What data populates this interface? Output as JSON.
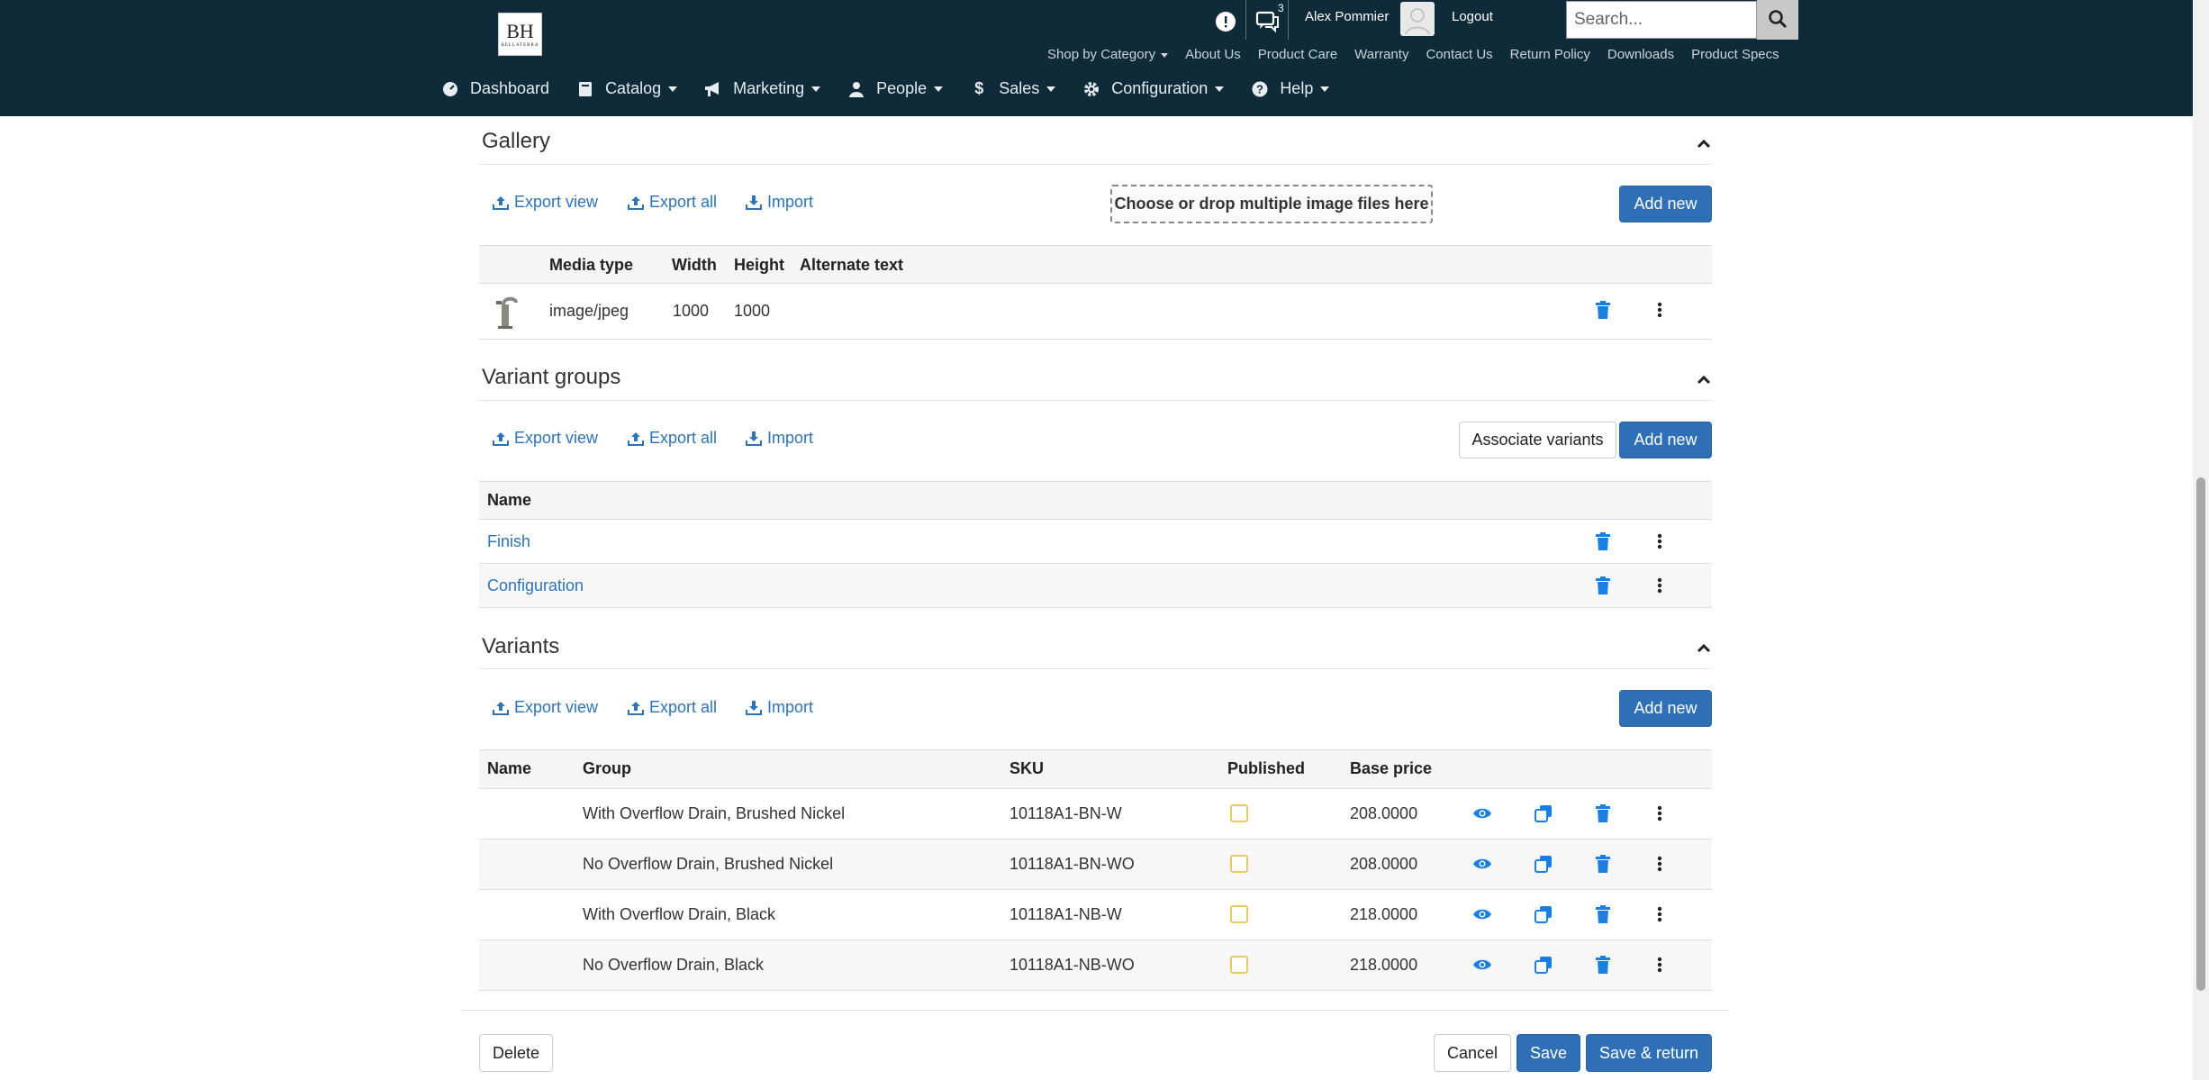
{
  "header": {
    "logo_text": "BH",
    "logo_sub": "BELLATERRA",
    "notifications_badge": "",
    "messages_badge": "3",
    "user_name": "Alex Pommier",
    "logout_label": "Logout",
    "search_placeholder": "Search...",
    "top_links": [
      "Shop by Category",
      "About Us",
      "Product Care",
      "Warranty",
      "Contact Us",
      "Return Policy",
      "Downloads",
      "Product Specs"
    ],
    "nav": [
      "Dashboard",
      "Catalog",
      "Marketing",
      "People",
      "Sales",
      "Configuration",
      "Help"
    ]
  },
  "toolbar": {
    "export_view": "Export view",
    "export_all": "Export all",
    "import": "Import",
    "add_new": "Add new"
  },
  "gallery": {
    "title": "Gallery",
    "dropzone": "Choose or drop multiple image files here",
    "columns": [
      "Media type",
      "Width",
      "Height",
      "Alternate text"
    ],
    "rows": [
      {
        "media_type": "image/jpeg",
        "width": "1000",
        "height": "1000",
        "alt": ""
      }
    ]
  },
  "variant_groups": {
    "title": "Variant groups",
    "associate_label": "Associate variants",
    "columns": [
      "Name"
    ],
    "rows": [
      {
        "name": "Finish"
      },
      {
        "name": "Configuration"
      }
    ]
  },
  "variants": {
    "title": "Variants",
    "columns": [
      "Name",
      "Group",
      "SKU",
      "Published",
      "Base price"
    ],
    "rows": [
      {
        "name": "",
        "group": "With Overflow Drain, Brushed Nickel",
        "sku": "10118A1-BN-W",
        "published": false,
        "price": "208.0000"
      },
      {
        "name": "",
        "group": "No Overflow Drain, Brushed Nickel",
        "sku": "10118A1-BN-WO",
        "published": false,
        "price": "208.0000"
      },
      {
        "name": "",
        "group": "With Overflow Drain, Black",
        "sku": "10118A1-NB-W",
        "published": false,
        "price": "218.0000"
      },
      {
        "name": "",
        "group": "No Overflow Drain, Black",
        "sku": "10118A1-NB-WO",
        "published": false,
        "price": "218.0000"
      }
    ]
  },
  "footer": {
    "delete": "Delete",
    "cancel": "Cancel",
    "save": "Save",
    "save_return": "Save & return"
  },
  "colors": {
    "header_bg": "#0f2b3a",
    "primary": "#2e6fb5",
    "link": "#2e73b8",
    "delete_icon": "#1a7fe0"
  }
}
